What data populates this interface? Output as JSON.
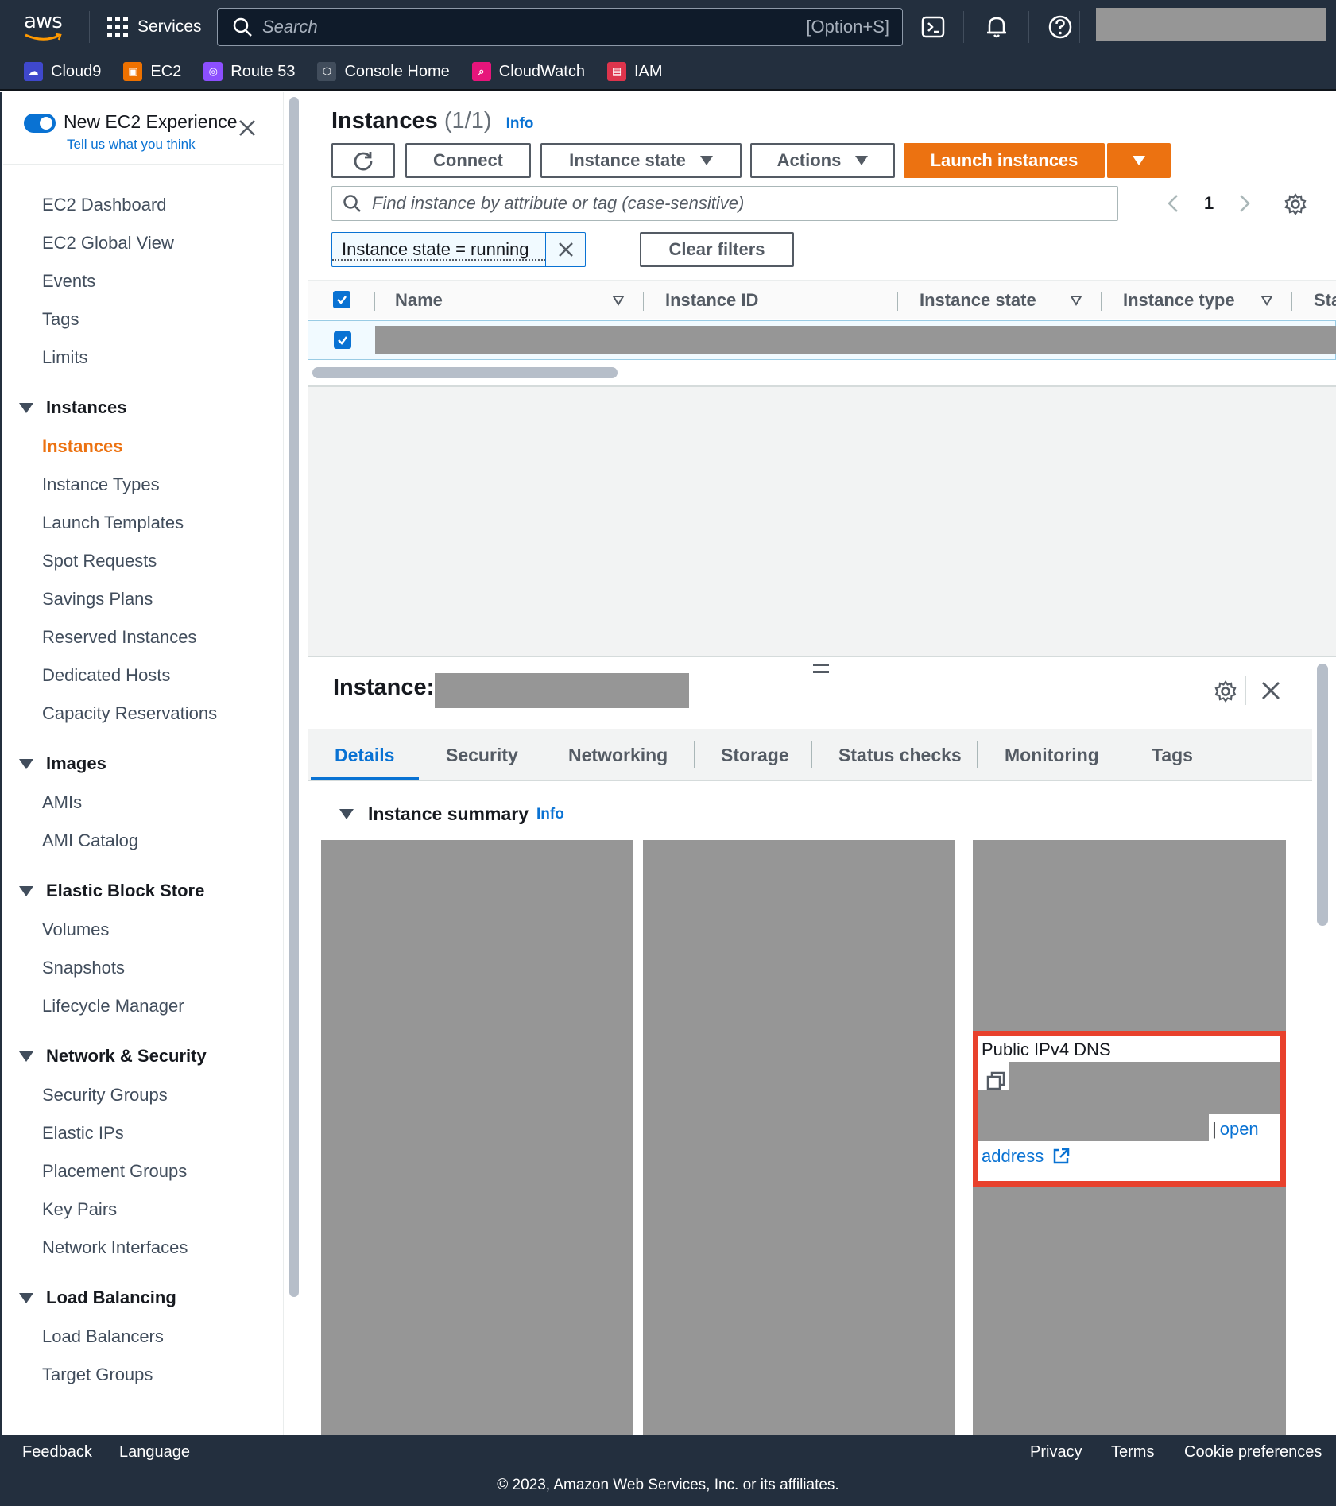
{
  "topnav": {
    "logo": "aws",
    "services_label": "Services",
    "search_placeholder": "Search",
    "search_shortcut": "[Option+S]",
    "icons": [
      "cloudshell-icon",
      "bell-icon",
      "help-icon"
    ],
    "favorites": [
      {
        "label": "Cloud9",
        "icon": "cloud9-icon",
        "color": "#3f48cc"
      },
      {
        "label": "EC2",
        "icon": "ec2-icon",
        "color": "#ed7100"
      },
      {
        "label": "Route 53",
        "icon": "route53-icon",
        "color": "#8c4fff"
      },
      {
        "label": "Console Home",
        "icon": "console-home-icon",
        "color": "#414d5c"
      },
      {
        "label": "CloudWatch",
        "icon": "cloudwatch-icon",
        "color": "#e7157b"
      },
      {
        "label": "IAM",
        "icon": "iam-icon",
        "color": "#dd344c"
      }
    ]
  },
  "sidebar": {
    "new_experience_title": "New EC2 Experience",
    "new_experience_sub": "Tell us what you think",
    "items_top": [
      "EC2 Dashboard",
      "EC2 Global View",
      "Events",
      "Tags",
      "Limits"
    ],
    "groups": [
      {
        "label": "Instances",
        "items": [
          "Instances",
          "Instance Types",
          "Launch Templates",
          "Spot Requests",
          "Savings Plans",
          "Reserved Instances",
          "Dedicated Hosts",
          "Capacity Reservations"
        ],
        "active": "Instances"
      },
      {
        "label": "Images",
        "items": [
          "AMIs",
          "AMI Catalog"
        ]
      },
      {
        "label": "Elastic Block Store",
        "items": [
          "Volumes",
          "Snapshots",
          "Lifecycle Manager"
        ]
      },
      {
        "label": "Network & Security",
        "items": [
          "Security Groups",
          "Elastic IPs",
          "Placement Groups",
          "Key Pairs",
          "Network Interfaces"
        ]
      },
      {
        "label": "Load Balancing",
        "items": [
          "Load Balancers",
          "Target Groups"
        ]
      }
    ]
  },
  "instances": {
    "title": "Instances",
    "count": "(1/1)",
    "info": "Info",
    "buttons": {
      "connect": "Connect",
      "instance_state": "Instance state",
      "actions": "Actions",
      "launch": "Launch instances"
    },
    "filter_placeholder": "Find instance by attribute or tag (case-sensitive)",
    "page": "1",
    "filter_token": "Instance state = running",
    "clear_filters": "Clear filters",
    "columns": [
      "Name",
      "Instance ID",
      "Instance state",
      "Instance type",
      "Sta"
    ]
  },
  "details": {
    "title": "Instance:",
    "tabs": [
      "Details",
      "Security",
      "Networking",
      "Storage",
      "Status checks",
      "Monitoring",
      "Tags"
    ],
    "active_tab": "Details",
    "summary_title": "Instance summary",
    "summary_info": "Info",
    "dns_label": "Public IPv4 DNS",
    "open_label": "open",
    "address_label": "address",
    "highlight_color": "#e8412c"
  },
  "footer": {
    "feedback": "Feedback",
    "language": "Language",
    "privacy": "Privacy",
    "terms": "Terms",
    "cookies": "Cookie preferences",
    "copyright": "© 2023, Amazon Web Services, Inc. or its affiliates."
  },
  "colors": {
    "nav_bg": "#232f3e",
    "accent_orange": "#ec7211",
    "link_blue": "#0972d3"
  }
}
